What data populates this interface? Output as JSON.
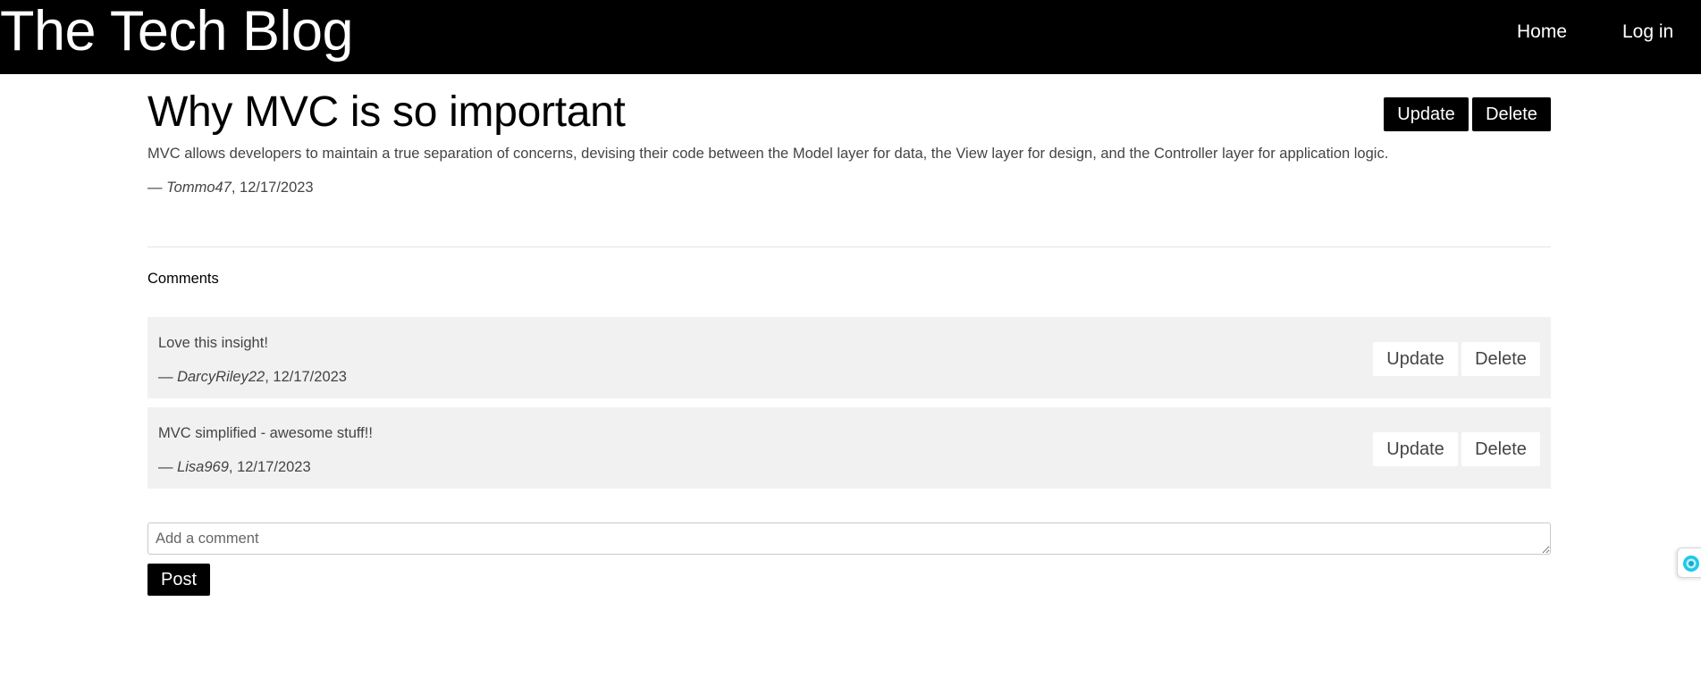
{
  "nav": {
    "brand": "The Tech Blog",
    "home": "Home",
    "login": "Log in"
  },
  "post": {
    "title": "Why MVC is so important",
    "body": "MVC allows developers to maintain a true separation of concerns, devising their code between the Model layer for data, the View layer for design, and the Controller layer for application logic.",
    "meta_prefix": "— ",
    "author": "Tommo47",
    "date": ", 12/17/2023",
    "update_label": "Update",
    "delete_label": "Delete"
  },
  "comments": {
    "heading": "Comments",
    "items": [
      {
        "text": "Love this insight!",
        "meta_prefix": "— ",
        "author": "DarcyRiley22",
        "date": ", 12/17/2023",
        "update_label": "Update",
        "delete_label": "Delete"
      },
      {
        "text": "MVC simplified - awesome stuff!!",
        "meta_prefix": "— ",
        "author": "Lisa969",
        "date": ", 12/17/2023",
        "update_label": "Update",
        "delete_label": "Delete"
      }
    ]
  },
  "new_comment": {
    "placeholder": "Add a comment",
    "value": "",
    "post_label": "Post"
  },
  "extension_widget": {
    "icon": "extension-badge-icon",
    "color": "#1ec8e6"
  },
  "colors": {
    "navbar": "#000000",
    "card": "#f1f1f1",
    "primary_button": "#000000"
  }
}
